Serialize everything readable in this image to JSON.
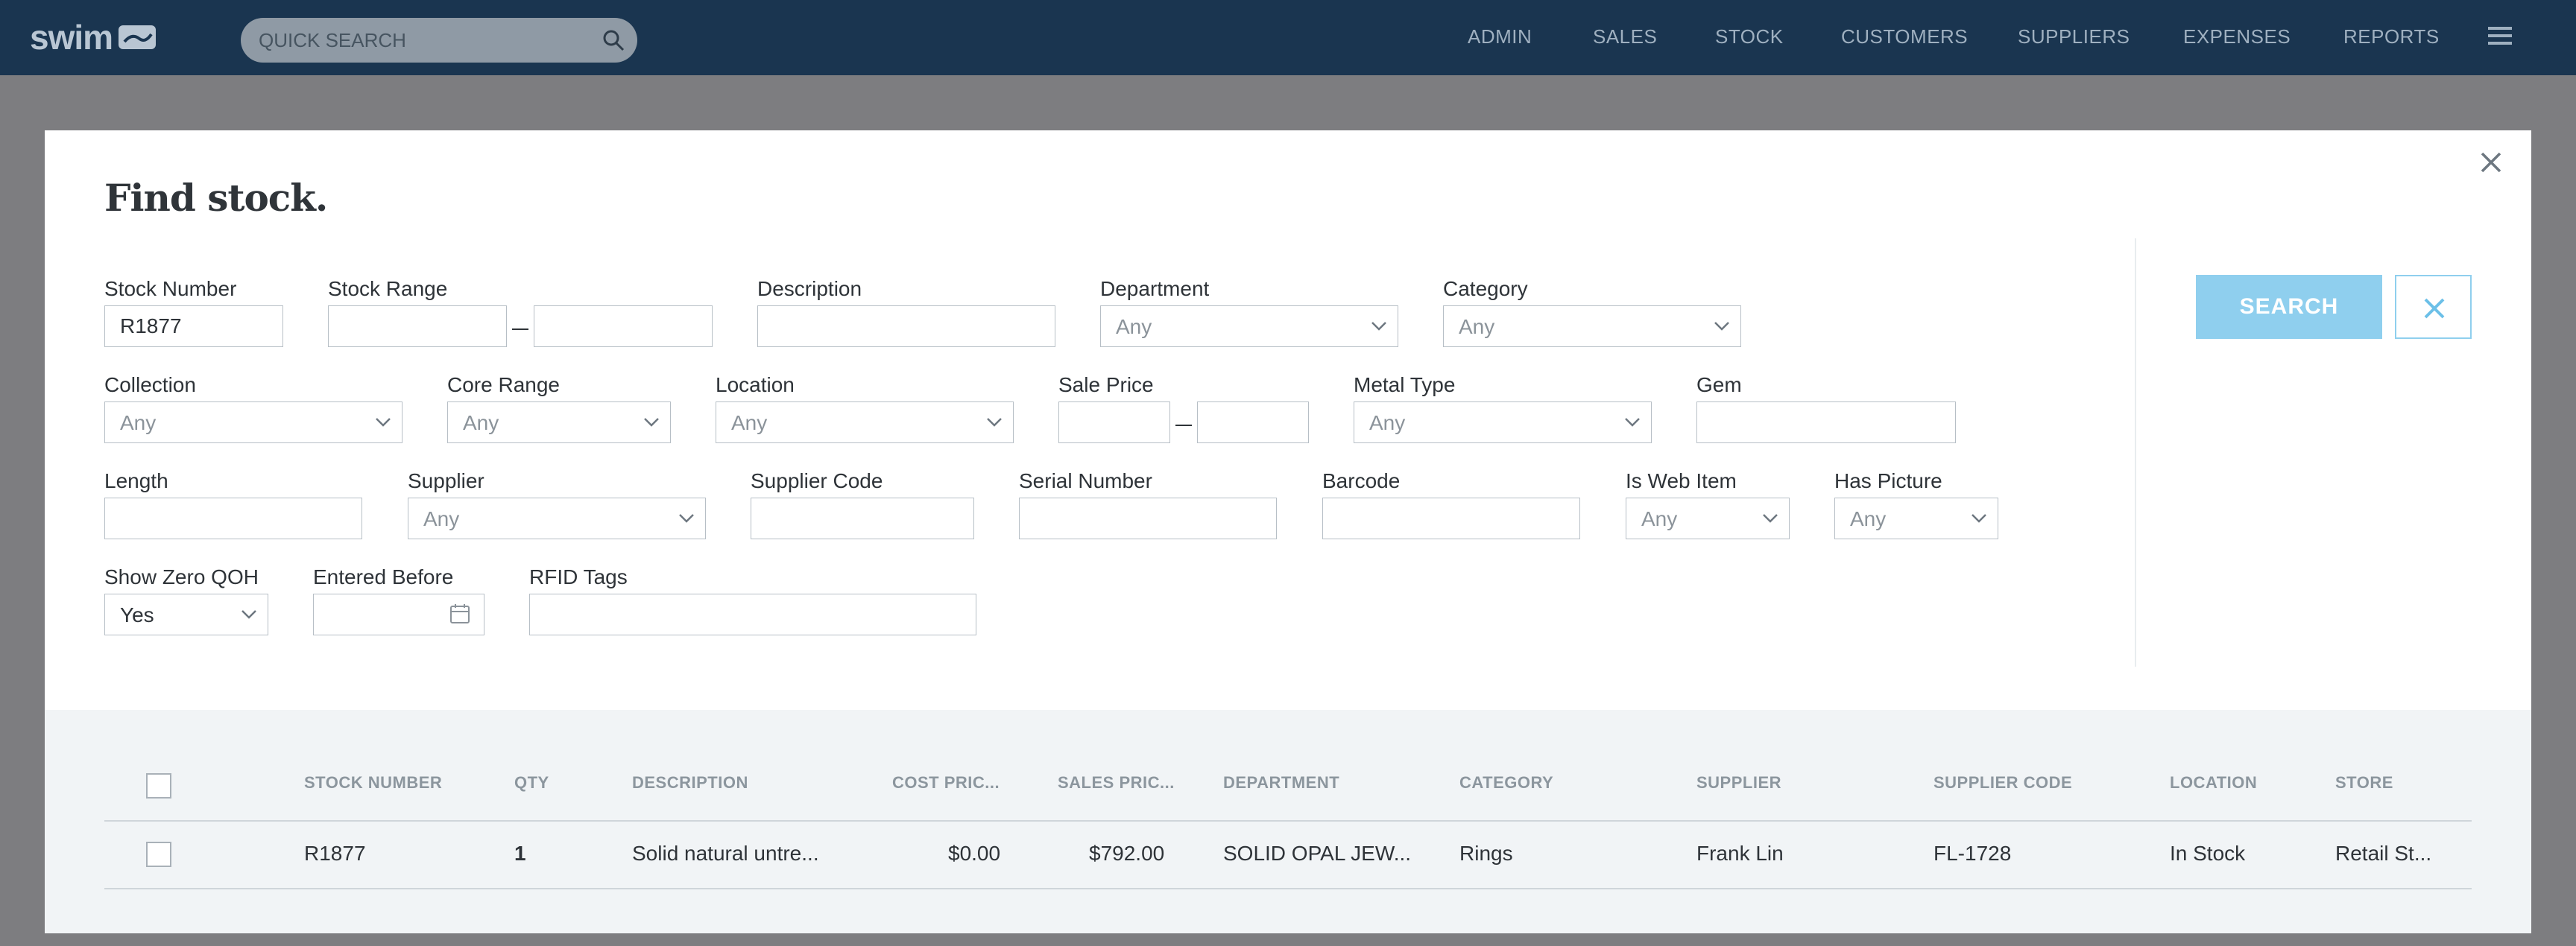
{
  "app": {
    "logo_text": "swim",
    "search_placeholder": "QUICK SEARCH",
    "nav": [
      "ADMIN",
      "SALES",
      "STOCK",
      "CUSTOMERS",
      "SUPPLIERS",
      "EXPENSES",
      "REPORTS"
    ]
  },
  "modal": {
    "title": "Find stock.",
    "search_label": "SEARCH",
    "fields": {
      "stock_number": {
        "label": "Stock Number",
        "value": "R1877"
      },
      "stock_range": {
        "label": "Stock Range",
        "from": "",
        "to": ""
      },
      "description": {
        "label": "Description",
        "value": ""
      },
      "department": {
        "label": "Department",
        "value": "Any"
      },
      "category": {
        "label": "Category",
        "value": "Any"
      },
      "collection": {
        "label": "Collection",
        "value": "Any"
      },
      "core_range": {
        "label": "Core Range",
        "value": "Any"
      },
      "location": {
        "label": "Location",
        "value": "Any"
      },
      "sale_price": {
        "label": "Sale Price",
        "from": "",
        "to": ""
      },
      "metal_type": {
        "label": "Metal Type",
        "value": "Any"
      },
      "gem": {
        "label": "Gem",
        "value": ""
      },
      "length": {
        "label": "Length",
        "value": ""
      },
      "supplier": {
        "label": "Supplier",
        "value": "Any"
      },
      "supplier_code": {
        "label": "Supplier Code",
        "value": ""
      },
      "serial_number": {
        "label": "Serial Number",
        "value": ""
      },
      "barcode": {
        "label": "Barcode",
        "value": ""
      },
      "is_web_item": {
        "label": "Is Web Item",
        "value": "Any"
      },
      "has_picture": {
        "label": "Has Picture",
        "value": "Any"
      },
      "show_zero_qoh": {
        "label": "Show Zero QOH",
        "value": "Yes"
      },
      "entered_before": {
        "label": "Entered Before",
        "value": ""
      },
      "rfid_tags": {
        "label": "RFID Tags",
        "value": ""
      }
    }
  },
  "results": {
    "columns": [
      "STOCK NUMBER",
      "QTY",
      "DESCRIPTION",
      "COST PRIC...",
      "SALES PRIC...",
      "DEPARTMENT",
      "CATEGORY",
      "SUPPLIER",
      "SUPPLIER CODE",
      "LOCATION",
      "STORE"
    ],
    "rows": [
      {
        "stock_number": "R1877",
        "qty": "1",
        "description": "Solid natural untre...",
        "cost_price": "$0.00",
        "sales_price": "$792.00",
        "department": "SOLID OPAL JEW...",
        "category": "Rings",
        "supplier": "Frank Lin",
        "supplier_code": "FL-1728",
        "location": "In Stock",
        "store": "Retail St..."
      }
    ]
  },
  "colors": {
    "topbar": "#1a3550",
    "accent": "#8fcfee",
    "overlay": "#7d7d80"
  },
  "icons": [
    "search-icon",
    "menu-icon",
    "close-icon",
    "chevron-down-icon",
    "calendar-icon",
    "x-icon"
  ]
}
